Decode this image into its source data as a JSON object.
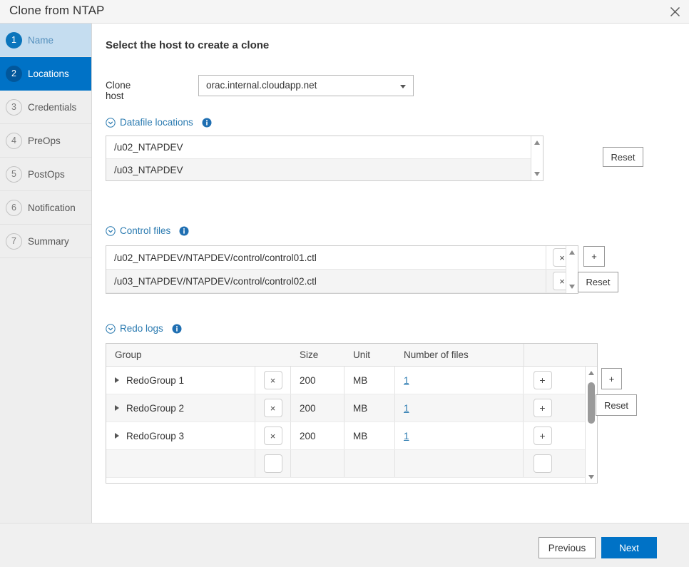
{
  "window": {
    "title": "Clone from NTAP",
    "close_icon": "close-icon"
  },
  "colors": {
    "accent": "#0072c6",
    "accent_dark": "#02579b",
    "link": "#2a7ab0",
    "step_done_bg": "#c5ddf0",
    "sidebar_bg": "#eeeeee"
  },
  "sidebar": {
    "steps": [
      {
        "num": "1",
        "label": "Name",
        "state": "done"
      },
      {
        "num": "2",
        "label": "Locations",
        "state": "active"
      },
      {
        "num": "3",
        "label": "Credentials",
        "state": "todo"
      },
      {
        "num": "4",
        "label": "PreOps",
        "state": "todo"
      },
      {
        "num": "5",
        "label": "PostOps",
        "state": "todo"
      },
      {
        "num": "6",
        "label": "Notification",
        "state": "todo"
      },
      {
        "num": "7",
        "label": "Summary",
        "state": "todo"
      }
    ]
  },
  "main": {
    "title": "Select the host to create a clone",
    "clone_host": {
      "label": "Clone host",
      "value": "orac.internal.cloudapp.net",
      "caret_icon": "chevron-down-icon"
    },
    "datafile_locations": {
      "title": "Datafile locations",
      "collapse_icon": "circle-chevron-down-icon",
      "info_icon": "info-icon",
      "reset_label": "Reset",
      "items": [
        "/u02_NTAPDEV",
        "/u03_NTAPDEV"
      ]
    },
    "control_files": {
      "title": "Control files",
      "collapse_icon": "circle-chevron-down-icon",
      "info_icon": "info-icon",
      "add_label": "+",
      "reset_label": "Reset",
      "delete_label": "×",
      "items": [
        "/u02_NTAPDEV/NTAPDEV/control/control01.ctl",
        "/u03_NTAPDEV/NTAPDEV/control/control02.ctl"
      ]
    },
    "redo_logs": {
      "title": "Redo logs",
      "collapse_icon": "circle-chevron-down-icon",
      "info_icon": "info-icon",
      "add_label": "+",
      "reset_label": "Reset",
      "delete_label": "×",
      "row_add_label": "+",
      "columns": [
        "Group",
        "Size",
        "Unit",
        "Number of files"
      ],
      "rows": [
        {
          "group": "RedoGroup 1",
          "size": "200",
          "unit": "MB",
          "files": "1"
        },
        {
          "group": "RedoGroup 2",
          "size": "200",
          "unit": "MB",
          "files": "1"
        },
        {
          "group": "RedoGroup 3",
          "size": "200",
          "unit": "MB",
          "files": "1"
        }
      ]
    }
  },
  "footer": {
    "previous_label": "Previous",
    "next_label": "Next"
  }
}
